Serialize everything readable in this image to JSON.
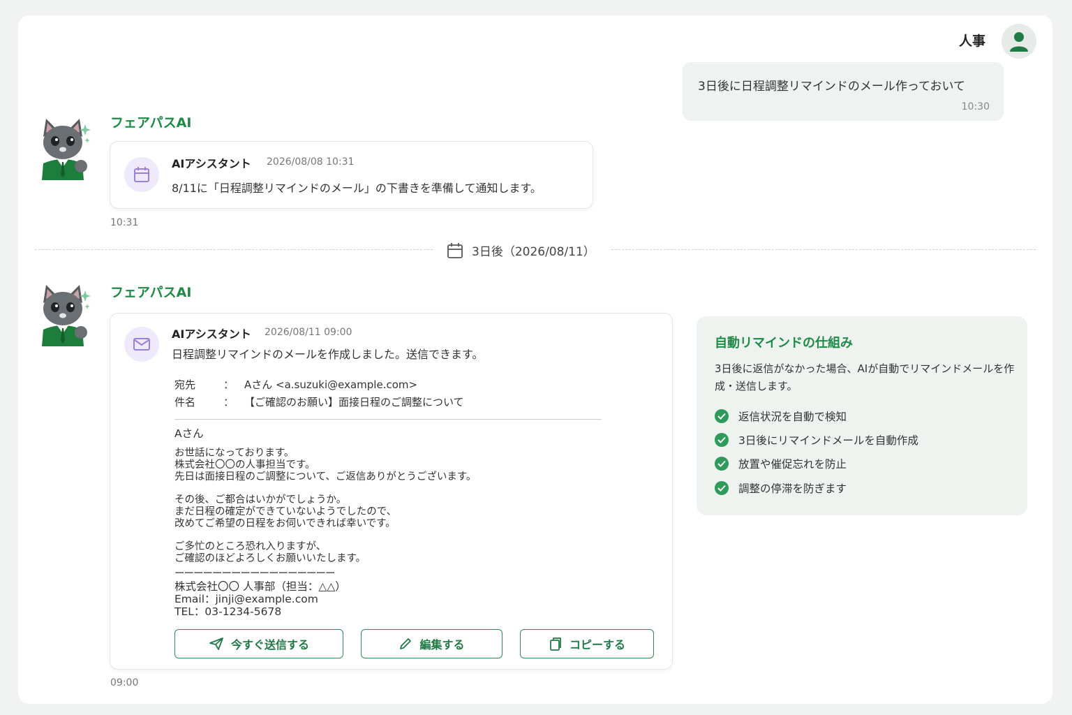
{
  "user": {
    "name": "人事",
    "message": "3日後に日程調整リマインドのメール作っておいて",
    "time": "10:30"
  },
  "bot_name": "フェアパスAI",
  "first_reply": {
    "sender": "AIアシスタント",
    "stamp": "2026/08/08 10:31",
    "text": "8/11に「日程調整リマインドのメール」の下書きを準備して通知します。",
    "time": "10:31"
  },
  "divider": {
    "label": "3日後（2026/08/11）"
  },
  "second_reply": {
    "sender": "AIアシスタント",
    "stamp": "2026/08/11 09:00",
    "text": "日程調整リマインドのメールを作成しました。送信できます。",
    "time": "09:00",
    "email": {
      "to_label": "宛先",
      "to_value": "Aさん <a.suzuki@example.com>",
      "subject_label": "件名",
      "subject_value": "【ご確認のお願い】面接日程のご調整について",
      "colon": "：",
      "greeting": "Aさん",
      "para1": [
        "お世話になっております。",
        "株式会社〇〇の人事担当です。",
        "先日は面接日程のご調整について、ご返信ありがとうございます。"
      ],
      "para2": [
        "その後、ご都合はいかがでしょうか。",
        "まだ日程の確定ができていないようでしたので、",
        "改めてご希望の日程をお伺いできれば幸いです。"
      ],
      "para3": [
        "ご多忙のところ恐れ入りますが、",
        "ご確認のほどよろしくお願いいたします。"
      ],
      "separator": "ーーーーーーーーーーーーーーーーー",
      "signature": [
        "株式会社〇〇 人事部（担当：△△）",
        "Email：jinji@example.com",
        "TEL：03-1234-5678"
      ]
    },
    "buttons": {
      "send": "今すぐ送信する",
      "edit": "編集する",
      "copy": "コピーする"
    }
  },
  "panel": {
    "title": "自動リマインドの仕組み",
    "description": "3日後に返信がなかった場合、AIが自動でリマインドメールを作成・送信します。",
    "items": [
      "返信状況を自動で検知",
      "3日後にリマインドメールを自動作成",
      "放置や催促忘れを防止",
      "調整の停滞を防ぎます"
    ]
  },
  "colors": {
    "accent": "#1e8a46",
    "check": "#2e9b5a",
    "icon_bg": "#efeafb",
    "icon_fg": "#9b7fd9"
  }
}
